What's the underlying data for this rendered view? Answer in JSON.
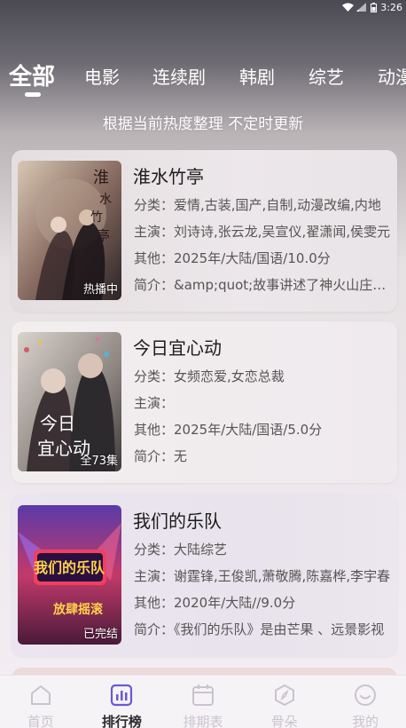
{
  "status": {
    "time": "3:26"
  },
  "tabs": [
    {
      "label": "全部"
    },
    {
      "label": "电影"
    },
    {
      "label": "连续剧"
    },
    {
      "label": "韩剧"
    },
    {
      "label": "综艺"
    },
    {
      "label": "动漫"
    }
  ],
  "subtitle": "根据当前热度整理 不定时更新",
  "items": [
    {
      "title": "淮水竹亭",
      "badge": "热播中",
      "category_label": "分类：",
      "category": "爱情,古装,国产,自制,动漫改编,内地",
      "cast_label": "主演：",
      "cast": "刘诗诗,张云龙,吴宣仪,翟潇闻,侯雯元",
      "other_label": "其他：",
      "other": "2025年/大陆/国语/10.0分",
      "intro_label": "简介：",
      "intro": "&amp;quot;故事讲述了神火山庄的故事"
    },
    {
      "title": "今日宜心动",
      "badge": "全73集",
      "category_label": "分类：",
      "category": "女频恋爱,女恋总裁",
      "cast_label": "主演：",
      "cast": "",
      "other_label": "其他：",
      "other": "2025年/大陆/国语/5.0分",
      "intro_label": "简介：",
      "intro": "无"
    },
    {
      "title": "我们的乐队",
      "badge": "已完结",
      "category_label": "分类：",
      "category": "大陆综艺",
      "cast_label": "主演：",
      "cast": "谢霆锋,王俊凯,萧敬腾,陈嘉桦,李宇春",
      "other_label": "其他：",
      "other": "2020年/大陆//9.0分",
      "intro_label": "简介：",
      "intro": "《我们的乐队》是由芒果 、远景影视"
    }
  ],
  "nav": [
    {
      "label": "首页",
      "icon": "home-icon"
    },
    {
      "label": "排行榜",
      "icon": "chart-icon"
    },
    {
      "label": "排期表",
      "icon": "calendar-icon"
    },
    {
      "label": "骨朵",
      "icon": "compass-icon"
    },
    {
      "label": "我的",
      "icon": "smiley-icon"
    }
  ],
  "colors": {
    "active_nav": "#6a5ad0",
    "inactive_nav": "#c9c3cd"
  }
}
